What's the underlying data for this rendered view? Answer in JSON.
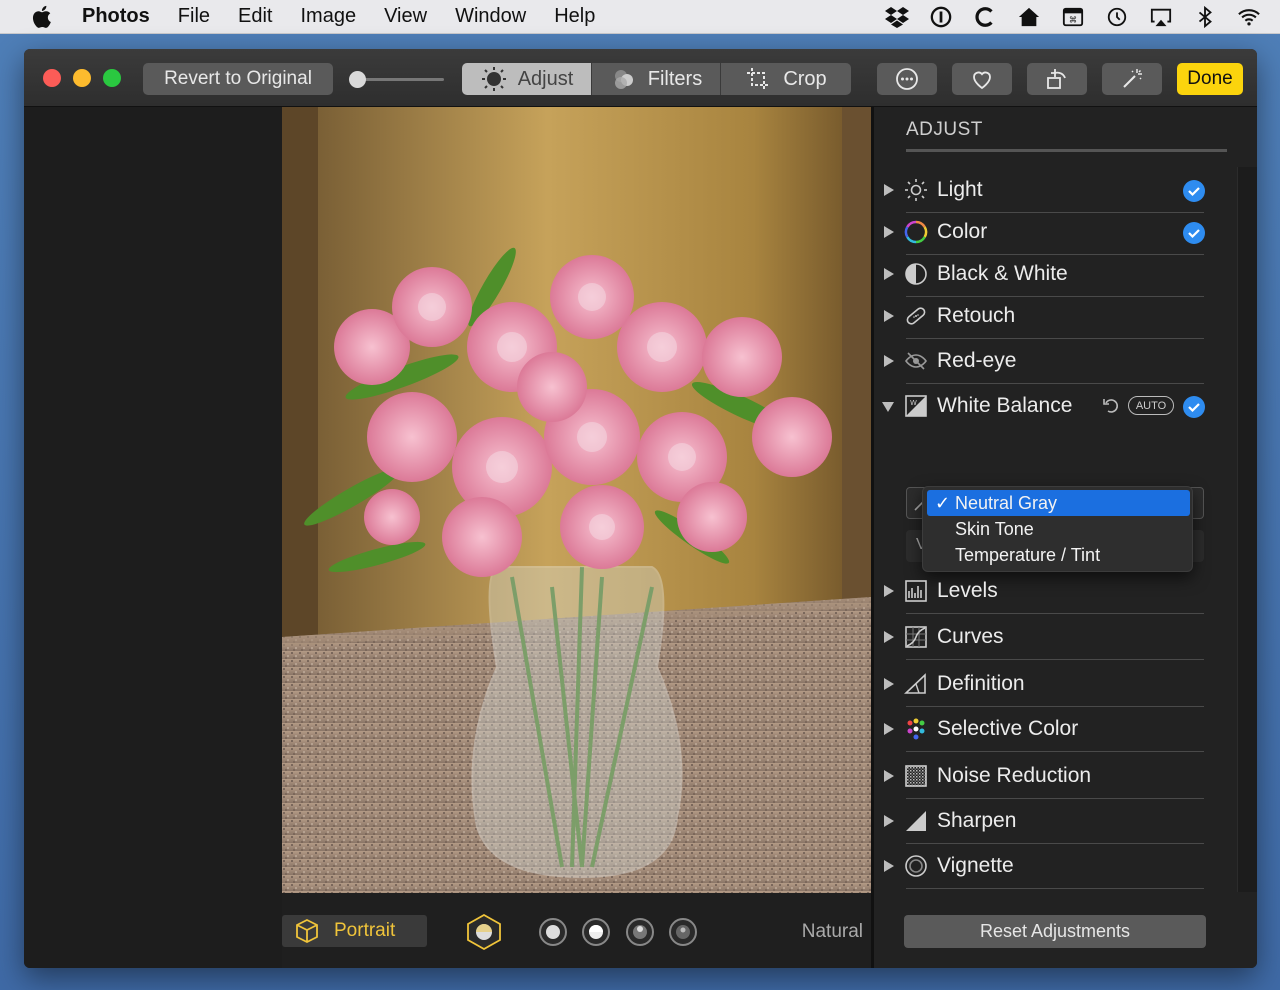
{
  "menubar": {
    "app_name": "Photos",
    "items": [
      "File",
      "Edit",
      "Image",
      "View",
      "Window",
      "Help"
    ],
    "status_icons": [
      "dropbox-icon",
      "info-icon",
      "c-app-icon",
      "home-icon",
      "keyboard-icon",
      "time-machine-icon",
      "airplay-icon",
      "bluetooth-icon",
      "wifi-icon"
    ]
  },
  "toolbar": {
    "revert_label": "Revert to Original",
    "tabs": [
      {
        "label": "Adjust",
        "icon": "adjust-icon",
        "active": true
      },
      {
        "label": "Filters",
        "icon": "filters-icon",
        "active": false
      },
      {
        "label": "Crop",
        "icon": "crop-icon",
        "active": false
      }
    ],
    "icon_buttons": [
      "more-icon",
      "heart-icon",
      "rotate-icon",
      "magic-wand-icon"
    ],
    "done_label": "Done",
    "accent": "#fbd40d"
  },
  "photo_bottom": {
    "portrait_label": "Portrait",
    "lighting_options": [
      "studio-light-icon",
      "light-1-icon",
      "light-2-icon",
      "light-3-icon",
      "light-4-icon"
    ],
    "lighting_value": "Natural"
  },
  "sidebar": {
    "title": "ADJUST",
    "items": [
      {
        "label": "Light",
        "icon": "sun-icon",
        "checked": true
      },
      {
        "label": "Color",
        "icon": "color-wheel-icon",
        "checked": true
      },
      {
        "label": "Black & White",
        "icon": "half-circle-icon",
        "checked": false
      },
      {
        "label": "Retouch",
        "icon": "bandage-icon",
        "checked": false
      },
      {
        "label": "Red-eye",
        "icon": "eye-icon",
        "checked": false
      },
      {
        "label": "White Balance",
        "icon": "white-balance-icon",
        "checked": true,
        "expanded": true,
        "auto_label": "AUTO"
      },
      {
        "label": "Levels",
        "icon": "levels-icon",
        "checked": false
      },
      {
        "label": "Curves",
        "icon": "curves-icon",
        "checked": false
      },
      {
        "label": "Definition",
        "icon": "definition-icon",
        "checked": false
      },
      {
        "label": "Selective Color",
        "icon": "dots-icon",
        "checked": false
      },
      {
        "label": "Noise Reduction",
        "icon": "noise-icon",
        "checked": false
      },
      {
        "label": "Sharpen",
        "icon": "sharpen-icon",
        "checked": false
      },
      {
        "label": "Vignette",
        "icon": "vignette-icon",
        "checked": false
      }
    ],
    "wb_dropdown": {
      "options": [
        "Neutral Gray",
        "Skin Tone",
        "Temperature / Tint"
      ],
      "selected": "Neutral Gray",
      "hidden_letter": "V"
    },
    "reset_label": "Reset Adjustments",
    "check_color": "#2e8cf0"
  }
}
